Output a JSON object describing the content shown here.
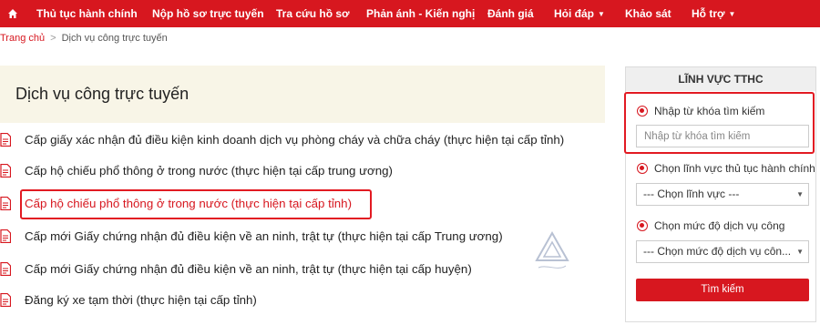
{
  "nav": {
    "items": [
      {
        "label": "Thủ tục hành chính",
        "dropdown": false
      },
      {
        "label": "Nộp hồ sơ trực tuyến",
        "dropdown": false
      },
      {
        "label": "Tra cứu hồ sơ",
        "dropdown": false
      },
      {
        "label": "Phản ánh - Kiến nghị",
        "dropdown": false
      },
      {
        "label": "Đánh giá",
        "dropdown": false
      },
      {
        "label": "Hỏi đáp",
        "dropdown": true
      },
      {
        "label": "Khảo sát",
        "dropdown": false
      },
      {
        "label": "Hỗ trợ",
        "dropdown": true
      }
    ],
    "background_color": "#d7171f"
  },
  "breadcrumb": {
    "home": "Trang chủ",
    "separator": ">",
    "current": "Dịch vụ công trực tuyến"
  },
  "main": {
    "title": "Dịch vụ công trực tuyến",
    "services": [
      {
        "label": "Cấp giấy xác nhận đủ điều kiện kinh doanh dịch vụ phòng cháy và chữa cháy (thực hiện tại cấp tỉnh)",
        "highlighted": false
      },
      {
        "label": "Cấp hộ chiếu phổ thông ở trong nước (thực hiện tại cấp trung ương)",
        "highlighted": false
      },
      {
        "label": "Cấp hộ chiếu phổ thông ở trong nước (thực hiện tại cấp tỉnh)",
        "highlighted": true
      },
      {
        "label": "Cấp mới Giấy chứng nhận đủ điều kiện về an ninh, trật tự (thực hiện tại cấp Trung ương)",
        "highlighted": false
      },
      {
        "label": "Cấp mới Giấy chứng nhận đủ điều kiện về an ninh, trật tự (thực hiện tại cấp huyện)",
        "highlighted": false
      },
      {
        "label": "Đăng ký xe tạm thời (thực hiện tại cấp tỉnh)",
        "highlighted": false
      }
    ]
  },
  "sidebar": {
    "title": "LĨNH VỰC TTHC",
    "keyword_option": "Nhập từ khóa tìm kiếm",
    "keyword_placeholder": "Nhập từ khóa tìm kiếm",
    "field_option": "Chọn lĩnh vực thủ tục hành chính",
    "field_select": "--- Chọn lĩnh vực ---",
    "level_option": "Chọn mức độ dịch vụ công",
    "level_select": "--- Chọn mức độ dịch vụ côn...",
    "search_button": "Tìm kiếm"
  },
  "icons": {
    "home": "home-icon",
    "service": "document-icon",
    "dropdown": "chevron-down-icon"
  },
  "colors": {
    "accent": "#d7171f",
    "heading_bg": "#f8f5e7",
    "highlight_border": "#e21a22"
  }
}
